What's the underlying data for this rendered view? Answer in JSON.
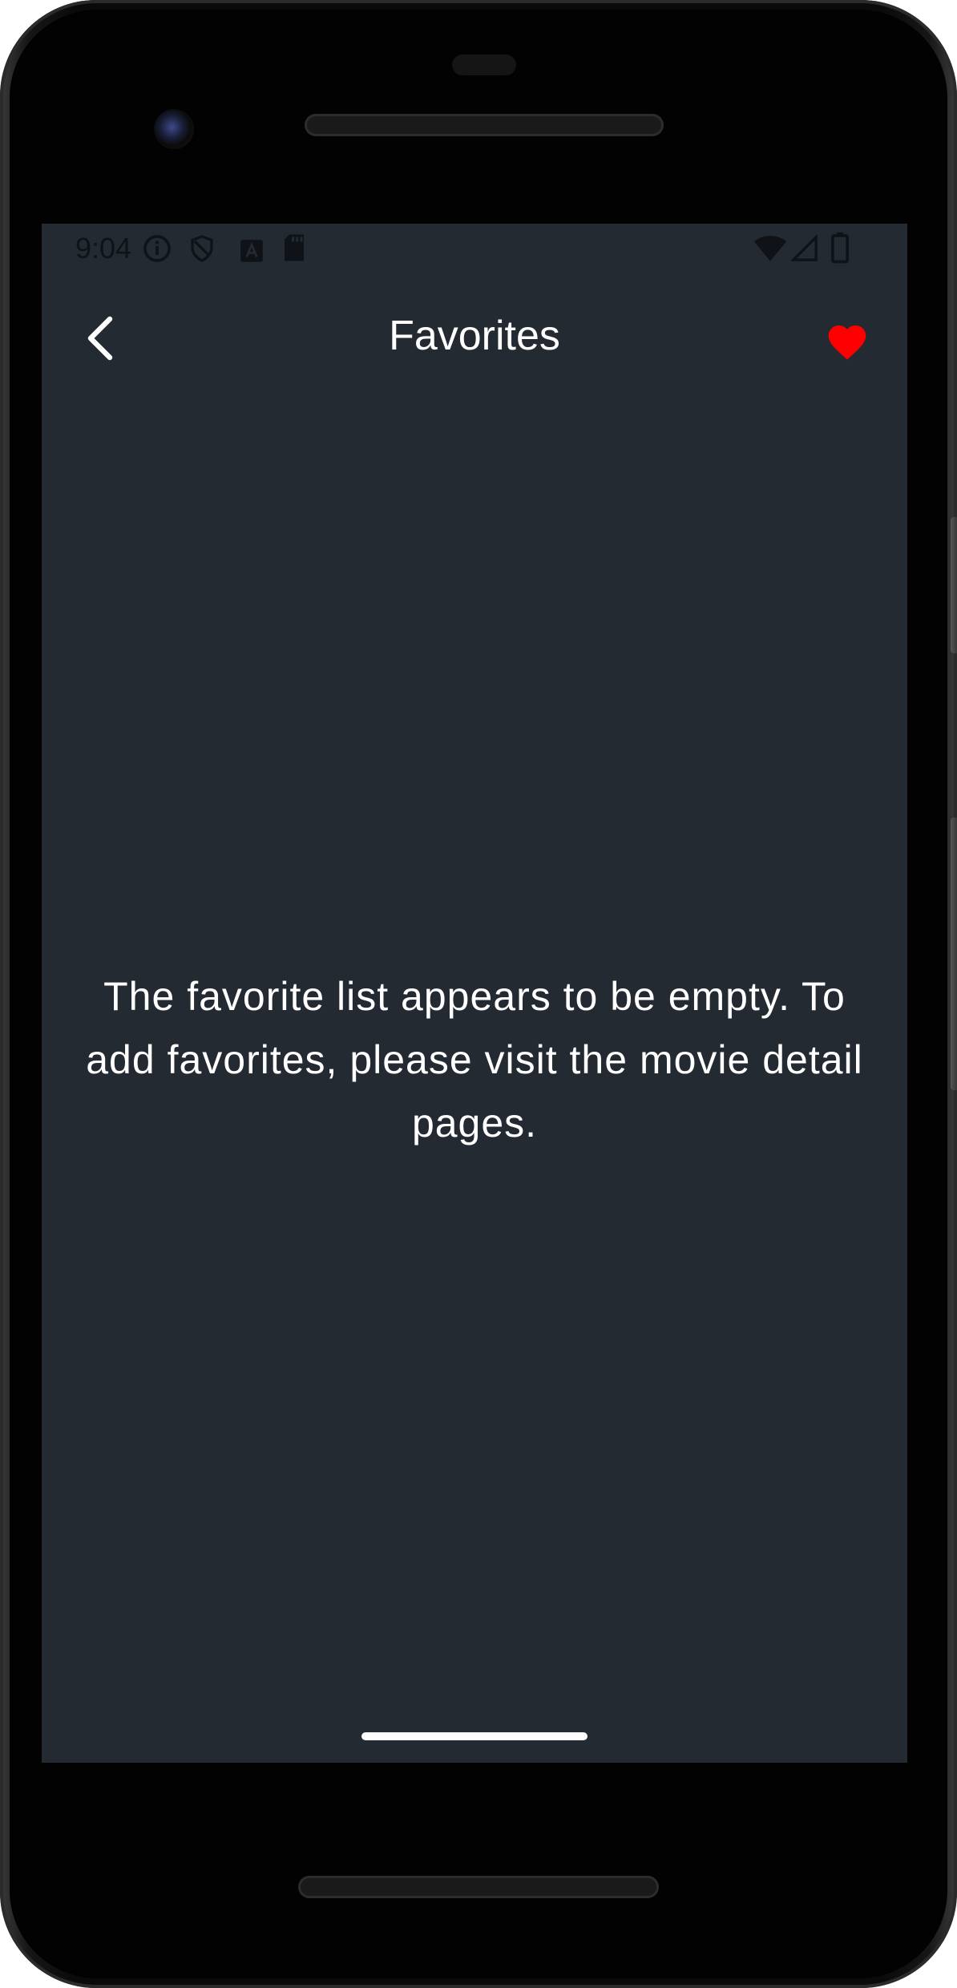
{
  "status_bar": {
    "time": "9:04",
    "icons": [
      "info-icon",
      "shield-icon",
      "font-a-icon",
      "sd-card-icon",
      "wifi-icon",
      "signal-icon",
      "battery-icon"
    ]
  },
  "app_bar": {
    "back_icon": "chevron-left-icon",
    "title": "Favorites",
    "favorite_icon": "heart-icon",
    "favorite_color": "#ff0000"
  },
  "content": {
    "empty_message": "The favorite list appears to be empty. To add favorites, please visit the movie detail pages."
  },
  "colors": {
    "background": "#242a32",
    "text": "#ffffff"
  }
}
